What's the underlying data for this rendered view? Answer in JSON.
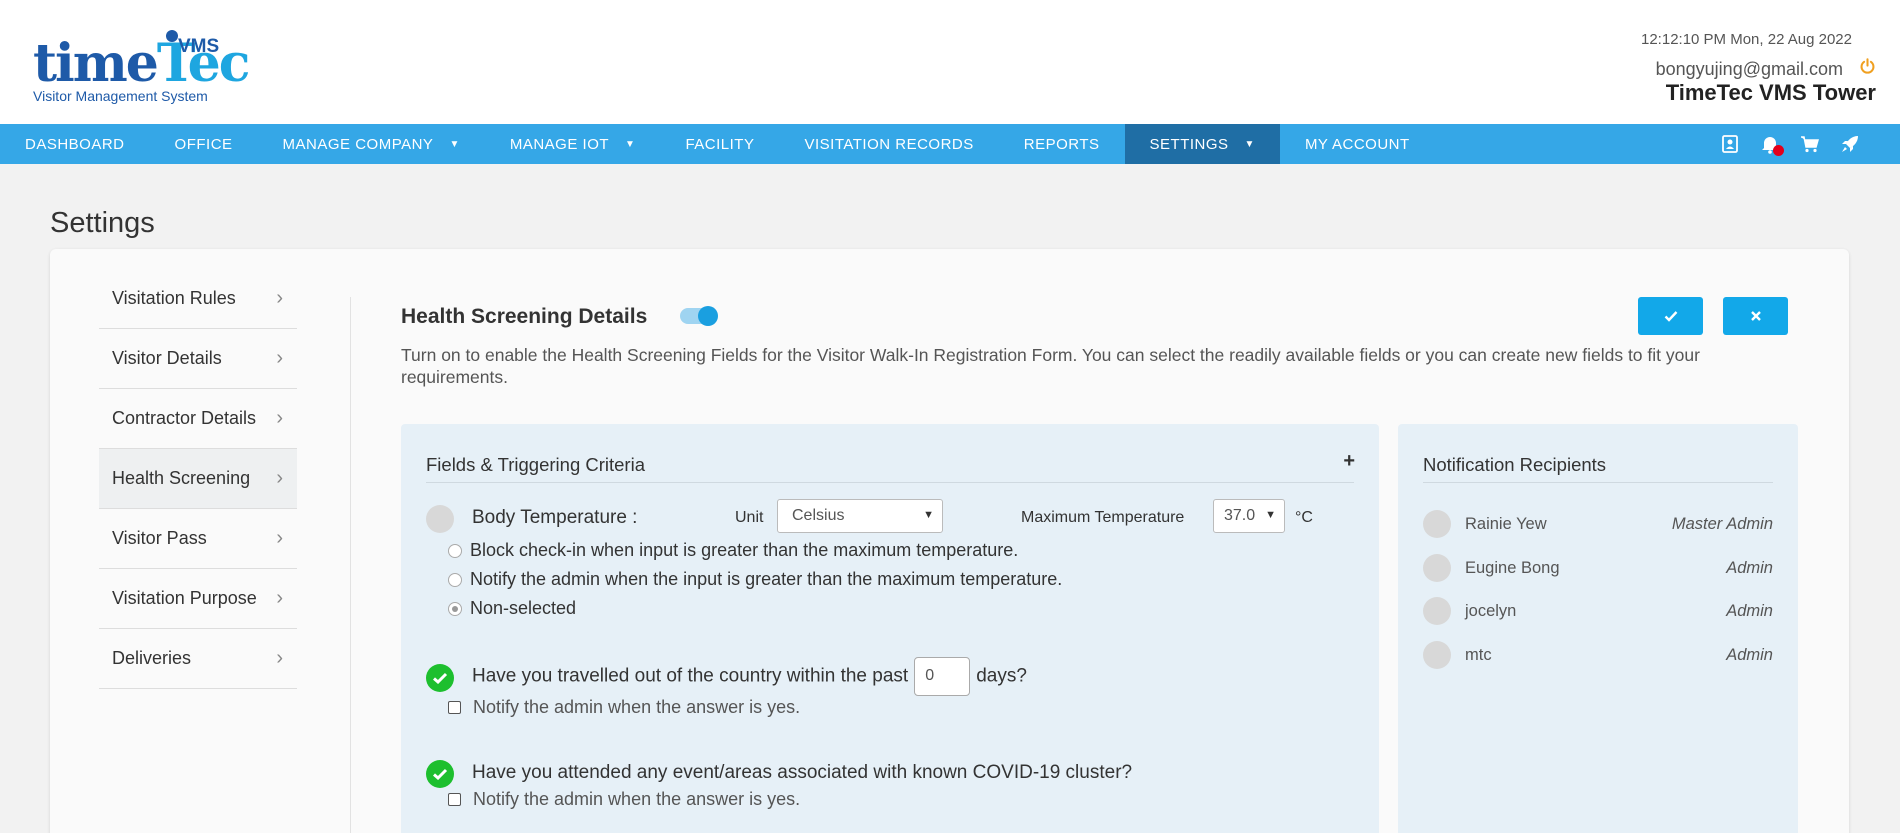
{
  "header": {
    "logo_word_a": "time",
    "logo_word_b": "Tec",
    "logo_vms": "VMS",
    "logo_subtitle": "Visitor Management System",
    "datetime": "12:12:10 PM  Mon, 22 Aug 2022",
    "email": "bongyujing@gmail.com",
    "company": "TimeTec VMS Tower"
  },
  "nav": {
    "items": [
      {
        "label": "DASHBOARD"
      },
      {
        "label": "OFFICE"
      },
      {
        "label": "MANAGE COMPANY"
      },
      {
        "label": "MANAGE IOT"
      },
      {
        "label": "FACILITY"
      },
      {
        "label": "VISITATION RECORDS"
      },
      {
        "label": "REPORTS"
      },
      {
        "label": "SETTINGS"
      },
      {
        "label": "MY ACCOUNT"
      }
    ],
    "icons": [
      "contact-card-icon",
      "notification-bell-icon",
      "shopping-cart-icon",
      "rocket-icon"
    ],
    "accent": "#35a7e7",
    "active_bg": "#1f6ea5"
  },
  "page": {
    "title": "Settings"
  },
  "sidebar": {
    "items": [
      {
        "label": "Visitation Rules"
      },
      {
        "label": "Visitor Details"
      },
      {
        "label": "Contractor Details"
      },
      {
        "label": "Health Screening"
      },
      {
        "label": "Visitor Pass"
      },
      {
        "label": "Visitation Purpose"
      },
      {
        "label": "Deliveries"
      }
    ],
    "active": "Health Screening"
  },
  "health": {
    "title": "Health Screening Details",
    "enabled": true,
    "description": "Turn on to enable the Health Screening Fields for the Visitor Walk-In Registration Form. You can select the readily available fields or you can create new fields to fit your requirements.",
    "save_icon": "check-icon",
    "cancel_icon": "close-icon"
  },
  "fields": {
    "title": "Fields & Triggering Criteria",
    "add_symbol": "+",
    "body_temp": {
      "label": "Body Temperature :",
      "unit_label": "Unit",
      "unit_value": "Celsius",
      "max_label": "Maximum Temperature",
      "max_value": "37.0",
      "unit_symbol": "°C",
      "options": [
        {
          "label": "Block check-in when input is greater than the maximum temperature.",
          "checked": false
        },
        {
          "label": "Notify the admin when the input is greater than the maximum temperature.",
          "checked": false
        },
        {
          "label": "Non-selected",
          "checked": true
        }
      ]
    },
    "travel": {
      "label_before": "Have you travelled out of the country within the past",
      "days_value": "0",
      "label_after": "days?",
      "notify": "Notify the admin when the answer is yes."
    },
    "covid": {
      "label": "Have you attended any event/areas associated with known COVID-19 cluster?",
      "notify": "Notify the admin when the answer is yes."
    }
  },
  "notifications": {
    "title": "Notification Recipients",
    "recipients": [
      {
        "name": "Rainie Yew",
        "role": "Master Admin"
      },
      {
        "name": "Eugine Bong",
        "role": "Admin"
      },
      {
        "name": "jocelyn",
        "role": "Admin"
      },
      {
        "name": "mtc",
        "role": "Admin"
      }
    ]
  }
}
